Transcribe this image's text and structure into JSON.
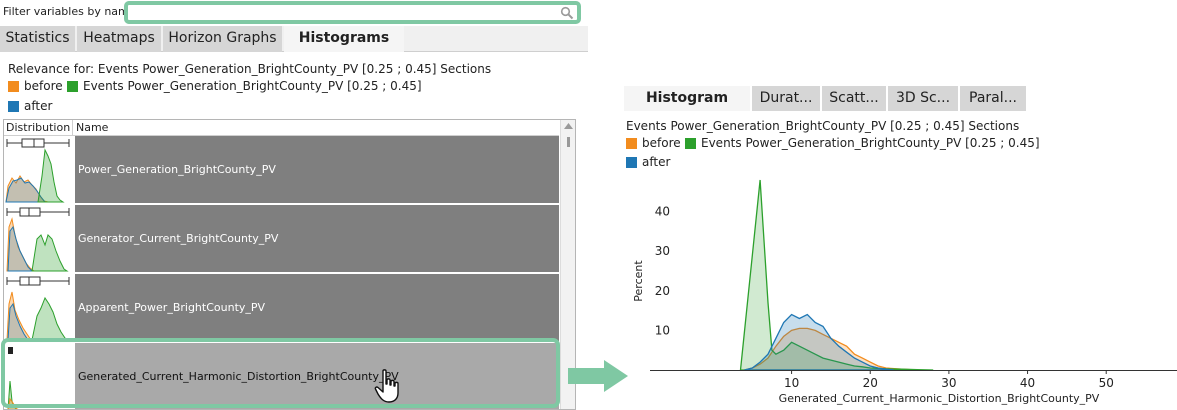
{
  "filter": {
    "label": "Filter variables by name:",
    "value": "",
    "placeholder": ""
  },
  "left_tabs": [
    {
      "label": "Statistics",
      "active": false
    },
    {
      "label": "Heatmaps",
      "active": false
    },
    {
      "label": "Horizon Graphs",
      "active": false
    },
    {
      "label": "Histograms",
      "active": true
    }
  ],
  "relevance": {
    "text": "Relevance for: Events Power_Generation_BrightCounty_PV [0.25 ; 0.45] Sections",
    "legend": [
      {
        "label": "before",
        "color": "#f28c1e"
      },
      {
        "label": "Events Power_Generation_BrightCounty_PV [0.25 ; 0.45]",
        "color": "#2ca02c"
      },
      {
        "label": "after",
        "color": "#1f77b4"
      }
    ]
  },
  "table": {
    "headers": {
      "distribution": "Distribution",
      "name": "Name"
    },
    "rows": [
      {
        "name": "Power_Generation_BrightCounty_PV",
        "selected": false
      },
      {
        "name": "Generator_Current_BrightCounty_PV",
        "selected": false
      },
      {
        "name": "Apparent_Power_BrightCounty_PV",
        "selected": false
      },
      {
        "name": "Generated_Current_Harmonic_Distortion_BrightCounty_PV",
        "selected": true
      }
    ]
  },
  "right_tabs": [
    {
      "label": "Histogram",
      "active": true
    },
    {
      "label": "Durat...",
      "active": false
    },
    {
      "label": "Scatt...",
      "active": false
    },
    {
      "label": "3D Sc...",
      "active": false
    },
    {
      "label": "Paral...",
      "active": false
    }
  ],
  "chart_panel": {
    "title": "Events Power_Generation_BrightCounty_PV [0.25 ; 0.45] Sections",
    "legend": [
      {
        "label": "before",
        "color": "#f28c1e"
      },
      {
        "label": "Events Power_Generation_BrightCounty_PV [0.25 ; 0.45]",
        "color": "#2ca02c"
      },
      {
        "label": "after",
        "color": "#1f77b4"
      }
    ]
  },
  "chart_data": {
    "type": "area",
    "title": "",
    "xlabel": "Generated_Current_Harmonic_Distortion_BrightCounty_PV",
    "ylabel": "Percent",
    "xlim": [
      -8,
      59
    ],
    "ylim": [
      0,
      49
    ],
    "xticks": [
      10,
      20,
      30,
      40,
      50
    ],
    "yticks": [
      10,
      20,
      30,
      40
    ],
    "grid": false,
    "legend_position": "top-left",
    "series": [
      {
        "name": "before",
        "color": "#f28c1e",
        "points": [
          [
            4,
            0
          ],
          [
            5,
            0.5
          ],
          [
            6,
            1.5
          ],
          [
            7,
            3
          ],
          [
            8,
            6
          ],
          [
            9,
            8.5
          ],
          [
            10,
            10
          ],
          [
            11,
            10.5
          ],
          [
            12,
            10.5
          ],
          [
            13,
            10
          ],
          [
            14,
            9
          ],
          [
            15,
            8
          ],
          [
            16,
            7
          ],
          [
            17,
            6
          ],
          [
            18,
            4
          ],
          [
            19,
            3
          ],
          [
            20,
            2
          ],
          [
            21,
            1
          ],
          [
            22,
            0.5
          ],
          [
            24,
            0.2
          ],
          [
            26,
            0
          ]
        ]
      },
      {
        "name": "Events Power_Generation_BrightCounty_PV [0.25 ; 0.45]",
        "color": "#2ca02c",
        "points": [
          [
            3.5,
            0
          ],
          [
            6,
            48
          ],
          [
            7,
            17
          ],
          [
            7.5,
            5
          ],
          [
            8,
            4
          ],
          [
            9,
            5
          ],
          [
            10,
            7
          ],
          [
            11,
            6
          ],
          [
            12,
            5
          ],
          [
            13,
            4
          ],
          [
            14,
            3
          ],
          [
            15,
            2.5
          ],
          [
            16,
            2
          ],
          [
            17,
            1.5
          ],
          [
            18,
            1
          ],
          [
            19,
            0.8
          ],
          [
            20,
            0.5
          ],
          [
            22,
            0.3
          ],
          [
            24,
            0.2
          ],
          [
            26,
            0.1
          ],
          [
            28,
            0
          ]
        ]
      },
      {
        "name": "after",
        "color": "#1f77b4",
        "points": [
          [
            4,
            0
          ],
          [
            5,
            0.5
          ],
          [
            6,
            2
          ],
          [
            7,
            4
          ],
          [
            8,
            8
          ],
          [
            9,
            12
          ],
          [
            10,
            14
          ],
          [
            11,
            13
          ],
          [
            12,
            14
          ],
          [
            13,
            12
          ],
          [
            14,
            11
          ],
          [
            15,
            8
          ],
          [
            16,
            6
          ],
          [
            17,
            4.5
          ],
          [
            18,
            3
          ],
          [
            19,
            2
          ],
          [
            20,
            1
          ],
          [
            21,
            0.5
          ],
          [
            22,
            0.2
          ],
          [
            23,
            0
          ]
        ]
      }
    ]
  },
  "colors": {
    "accent": "#7fc8a3",
    "before": "#f28c1e",
    "event": "#2ca02c",
    "after": "#1f77b4"
  },
  "icons": {
    "search": "magnifier-icon",
    "cursor": "hand-pointer-icon",
    "arrow": "flow-arrow-icon"
  }
}
